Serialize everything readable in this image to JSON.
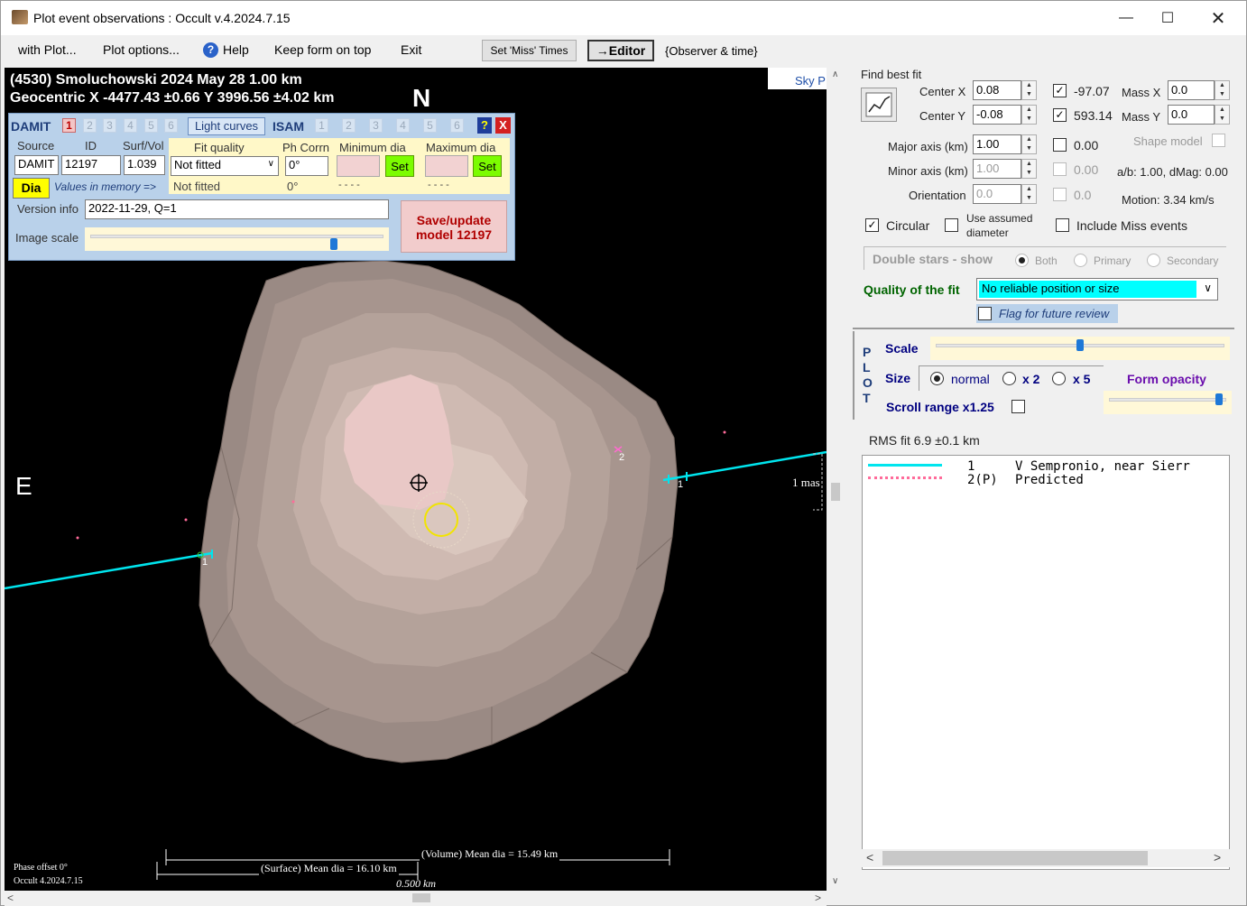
{
  "window": {
    "title": "Plot event observations : Occult v.4.2024.7.15"
  },
  "menu": {
    "with_plot": "with Plot...",
    "plot_options": "Plot options...",
    "help": "Help",
    "keep_on_top": "Keep form on top",
    "exit": "Exit",
    "set_miss": "Set 'Miss' Times",
    "editor": "→Editor",
    "observer_time": "{Observer & time}"
  },
  "plot": {
    "line1": "(4530) Smoluchowski  2024 May 28   1.00 km",
    "line2": "Geocentric  X  -4477.43 ±0.66  Y 3996.56 ±4.02 km",
    "north": "N",
    "east": "E",
    "sky_label": "Sky P",
    "mas_label": "1 mas",
    "chord1_label_left": "1",
    "chord1_label_right": "1",
    "chord2_label": "2",
    "volume_dia": "(Volume) Mean dia = 15.49 km",
    "surface_dia": "(Surface) Mean dia = 16.10 km",
    "scale_km": "0.500 km",
    "phase_offset": "Phase offset 0°",
    "version": "Occult 4.2024.7.15"
  },
  "damit": {
    "label": "DAMIT",
    "models": [
      "1",
      "2",
      "3",
      "4",
      "5",
      "6"
    ],
    "light_curves": "Light curves",
    "isam": "ISAM",
    "isam_models": [
      "1",
      "2",
      "3",
      "4",
      "5",
      "6"
    ],
    "help": "?",
    "close": "X",
    "hdr_source": "Source",
    "hdr_id": "ID",
    "hdr_surfvol": "Surf/Vol",
    "hdr_fit": "Fit quality",
    "hdr_ph": "Ph Corrn",
    "hdr_min": "Minimum dia",
    "hdr_max": "Maximum dia",
    "source_val": "DAMIT",
    "id_val": "12197",
    "surfvol_val": "1.039",
    "fit_val": "Not fitted",
    "ph_val": "0°",
    "set_label": "Set",
    "dia_btn": "Dia",
    "values_memory": "Values in memory =>",
    "mem_fit": "Not fitted",
    "mem_ph": "0°",
    "mem_min": "- - - -",
    "mem_max": "- - - -",
    "version_label": "Version info",
    "version_val": "2022-11-29, Q=1",
    "image_scale": "Image scale",
    "save_line1": "Save/update",
    "save_line2": "model  12197"
  },
  "fit": {
    "find_best_fit": "Find best fit",
    "center_x_label": "Center X",
    "center_x": "0.08",
    "center_y_label": "Center Y",
    "center_y": "-0.08",
    "cx_val": "-97.07",
    "cy_val": "593.14",
    "mass_x_label": "Mass X",
    "mass_x": "0.0",
    "mass_y_label": "Mass Y",
    "mass_y": "0.0",
    "major_label": "Major axis (km)",
    "major": "1.00",
    "major_chk_val": "0.00",
    "minor_label": "Minor axis (km)",
    "minor": "1.00",
    "minor_chk_val": "0.00",
    "orient_label": "Orientation",
    "orient": "0.0",
    "orient_chk_val": "0.0",
    "shape_model": "Shape model",
    "ab_dmag": "a/b: 1.00, dMag: 0.00",
    "motion": "Motion: 3.34 km/s",
    "circular": "Circular",
    "use_assumed1": "Use assumed",
    "use_assumed2": "diameter",
    "include_miss": "Include Miss events",
    "double_stars": "Double stars - show",
    "both": "Both",
    "primary": "Primary",
    "secondary": "Secondary",
    "quality_label": "Quality of the fit",
    "quality_val": "No reliable position or size",
    "flag_review": "Flag for future review"
  },
  "plotctl": {
    "letters": [
      "P",
      "L",
      "O",
      "T"
    ],
    "scale": "Scale",
    "size": "Size",
    "normal": "normal",
    "x2": "x 2",
    "x5": "x 5",
    "form_opacity": "Form opacity",
    "scroll_range": "Scroll range x1.25",
    "rms": "RMS fit 6.9 ±0.1 km",
    "scale_level": 0.5,
    "opacity_level": 0.98
  },
  "legend": [
    {
      "num": "1",
      "text": "V Sempronio, near Sierr"
    },
    {
      "num": "2(P)",
      "text": "Predicted"
    }
  ],
  "colors": {
    "chord": "#00e5ee",
    "predicted": "#ff6b9a",
    "quality_bg": "#00ffff"
  }
}
